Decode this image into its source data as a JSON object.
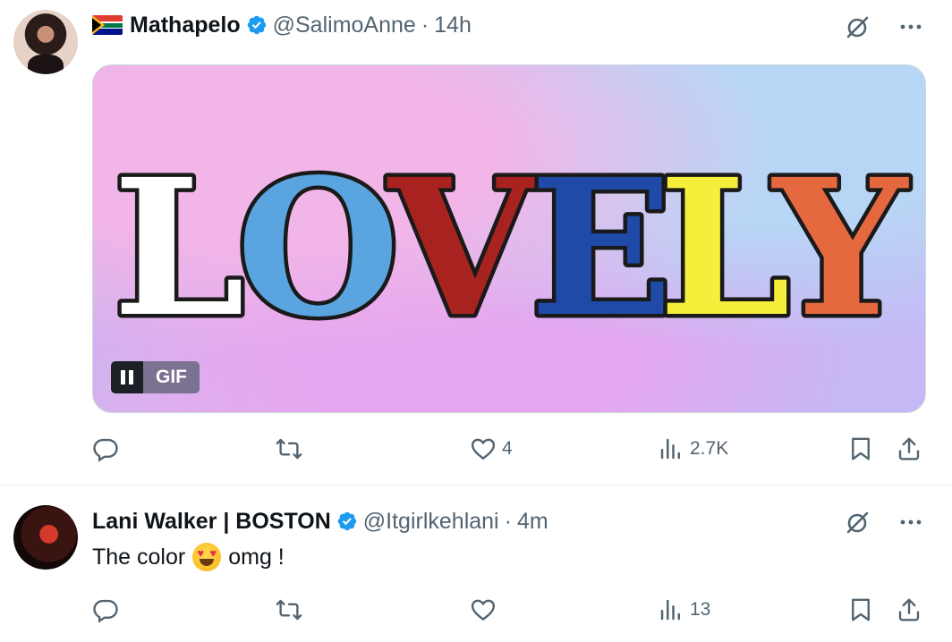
{
  "tweets": [
    {
      "author": {
        "name": "Mathapelo",
        "flag": "south-africa-flag",
        "verified": true,
        "handle": "@SalimoAnne",
        "separator": "·",
        "time": "14h"
      },
      "media": {
        "type": "gif",
        "word": "LOVELY",
        "letter_colors": [
          "#ffffff",
          "#5aa5e0",
          "#a8231f",
          "#1f4aa8",
          "#f5ee3a",
          "#e5683f"
        ],
        "badge_label": "GIF"
      },
      "actions": {
        "reply_count": "",
        "retweet_count": "",
        "like_count": "4",
        "views": "2.7K"
      }
    },
    {
      "author": {
        "name": "Lani Walker | BOSTON",
        "verified": true,
        "handle": "@Itgirlkehlani",
        "separator": "·",
        "time": "4m"
      },
      "text_before": "The color",
      "emoji": "heart-eyes-emoji",
      "text_after": "omg !",
      "actions": {
        "reply_count": "",
        "retweet_count": "",
        "like_count": "",
        "views": "13"
      }
    }
  ],
  "icons": {
    "grok": "grok-icon",
    "more": "more-icon",
    "reply": "reply-icon",
    "retweet": "retweet-icon",
    "like": "heart-icon",
    "views": "views-icon",
    "bookmark": "bookmark-icon",
    "share": "share-icon"
  },
  "colors": {
    "verified": "#1d9bf0",
    "secondary_text": "#536471",
    "primary_text": "#0f1419"
  }
}
